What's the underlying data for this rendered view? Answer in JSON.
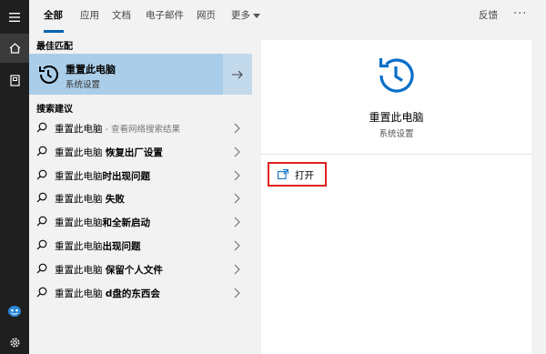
{
  "colors": {
    "accent": "#0063b1",
    "taskbar": "#1f1f1f",
    "selected_row": "#aacde9",
    "highlight_box": "#e0201f"
  },
  "taskbar": {
    "icons": [
      "hamburger-icon",
      "home-icon",
      "notebook-icon",
      "cortana-icon",
      "settings-icon"
    ]
  },
  "nav": {
    "tabs": [
      {
        "label": "全部",
        "active": true
      },
      {
        "label": "应用"
      },
      {
        "label": "文档"
      },
      {
        "label": "电子邮件"
      },
      {
        "label": "网页"
      },
      {
        "label": "更多"
      }
    ],
    "feedback": "反馈",
    "more_options": "···"
  },
  "best_match": {
    "heading": "最佳匹配",
    "title": "重置此电脑",
    "subtitle": "系统设置",
    "icon": "history-icon"
  },
  "suggestions": {
    "heading": "搜索建议",
    "items": [
      {
        "main": "重置此电脑",
        "hint": " - 查看网络搜索结果",
        "bold": ""
      },
      {
        "main": "重置此电脑 ",
        "hint": "",
        "bold": "恢复出厂设置"
      },
      {
        "main": "重置此电脑",
        "hint": "",
        "bold": "时出现问题"
      },
      {
        "main": "重置此电脑 ",
        "hint": "",
        "bold": "失败"
      },
      {
        "main": "重置此电脑",
        "hint": "",
        "bold": "和全新启动"
      },
      {
        "main": "重置此电脑",
        "hint": "",
        "bold": "出现问题"
      },
      {
        "main": "重置此电脑 ",
        "hint": "",
        "bold": "保留个人文件"
      },
      {
        "main": "重置此电脑 ",
        "hint": "",
        "bold": "d盘的东西会"
      }
    ]
  },
  "preview": {
    "title": "重置此电脑",
    "subtitle": "系统设置",
    "action_open": "打开",
    "icon": "history-icon"
  }
}
